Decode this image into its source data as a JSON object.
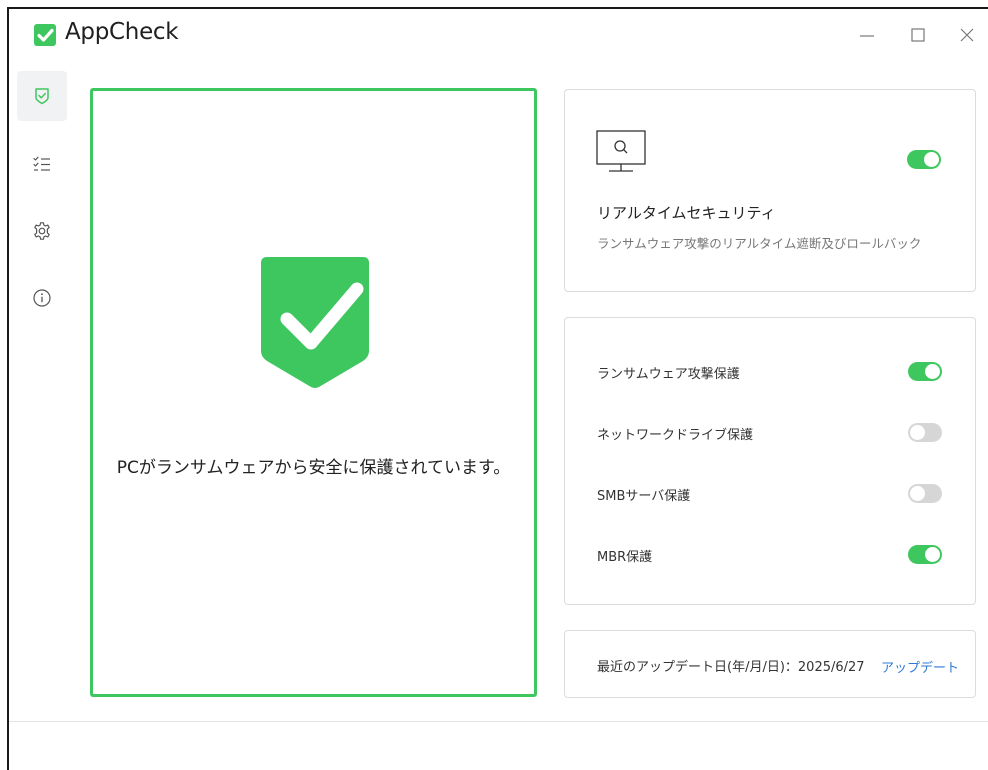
{
  "window": {
    "title": "AppCheck"
  },
  "colors": {
    "accent": "#3fc75f",
    "link": "#2d7ad6",
    "toggle_off": "#d6d6d6"
  },
  "sidebar": {
    "items": [
      {
        "icon": "shield-check-icon",
        "active": true
      },
      {
        "icon": "checklist-icon",
        "active": false
      },
      {
        "icon": "gear-icon",
        "active": false
      },
      {
        "icon": "info-icon",
        "active": false
      }
    ]
  },
  "status": {
    "message": "PCがランサムウェアから安全に保護されています。",
    "icon": "shield-check-icon"
  },
  "realtime": {
    "icon": "monitor-search-icon",
    "title": "リアルタイムセキュリティ",
    "description": "ランサムウェア攻撃のリアルタイム遮断及びロールバック",
    "enabled": true
  },
  "protections": [
    {
      "label": "ランサムウェア攻撃保護",
      "enabled": true
    },
    {
      "label": "ネットワークドライブ保護",
      "enabled": false
    },
    {
      "label": "SMBサーバ保護",
      "enabled": false
    },
    {
      "label": "MBR保護",
      "enabled": true
    }
  ],
  "update": {
    "label": "最近のアップデート日(年/月/日)：2025/6/27",
    "button_label": "アップデート"
  }
}
